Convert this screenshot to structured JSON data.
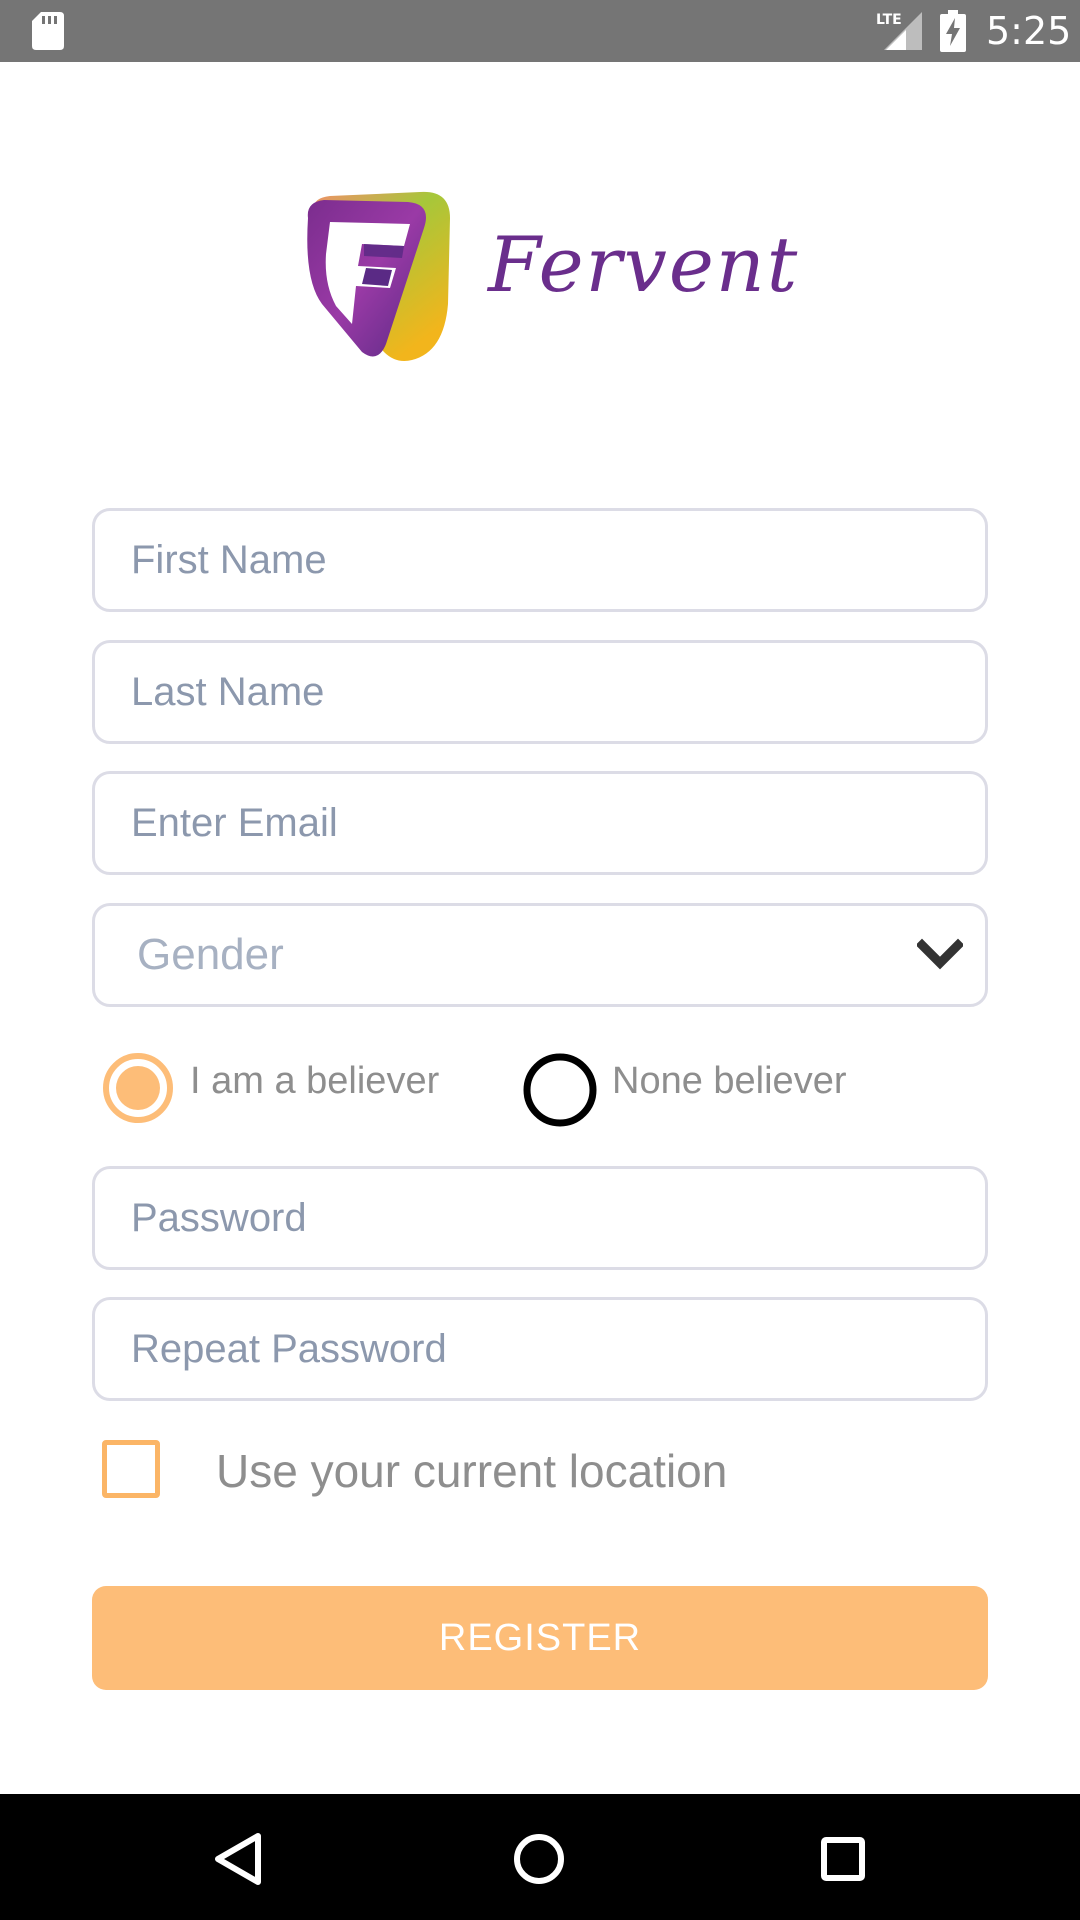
{
  "status_bar": {
    "time": "5:25",
    "network": "LTE",
    "icons": [
      "sd-card-icon",
      "lte-signal-icon",
      "battery-charging-icon"
    ]
  },
  "brand": {
    "name": "Fervent",
    "mark_letter": "F",
    "colors": {
      "purple": "#6a2e8c",
      "green": "#8dc63f",
      "gold": "#f2b51c"
    }
  },
  "form": {
    "first_name": {
      "placeholder": "First Name",
      "value": ""
    },
    "last_name": {
      "placeholder": "Last Name",
      "value": ""
    },
    "email": {
      "placeholder": "Enter Email",
      "value": ""
    },
    "gender": {
      "selected": "Gender",
      "icon": "chevron-down-icon"
    },
    "belief": {
      "options": [
        {
          "label": "I am a believer",
          "selected": true
        },
        {
          "label": "None believer",
          "selected": false
        }
      ]
    },
    "password": {
      "placeholder": "Password",
      "value": ""
    },
    "repeat_password": {
      "placeholder": "Repeat Password",
      "value": ""
    },
    "location": {
      "label": "Use your current location",
      "checked": false
    },
    "register_label": "REGISTER"
  },
  "colors": {
    "accent": "#fdbd78",
    "accent_border": "#fbb566",
    "field_border": "#dcdce6",
    "placeholder": "#8c98ad",
    "status_bar": "#757575"
  },
  "nav_bar": {
    "buttons": [
      "back-icon",
      "home-icon",
      "recents-icon"
    ]
  }
}
